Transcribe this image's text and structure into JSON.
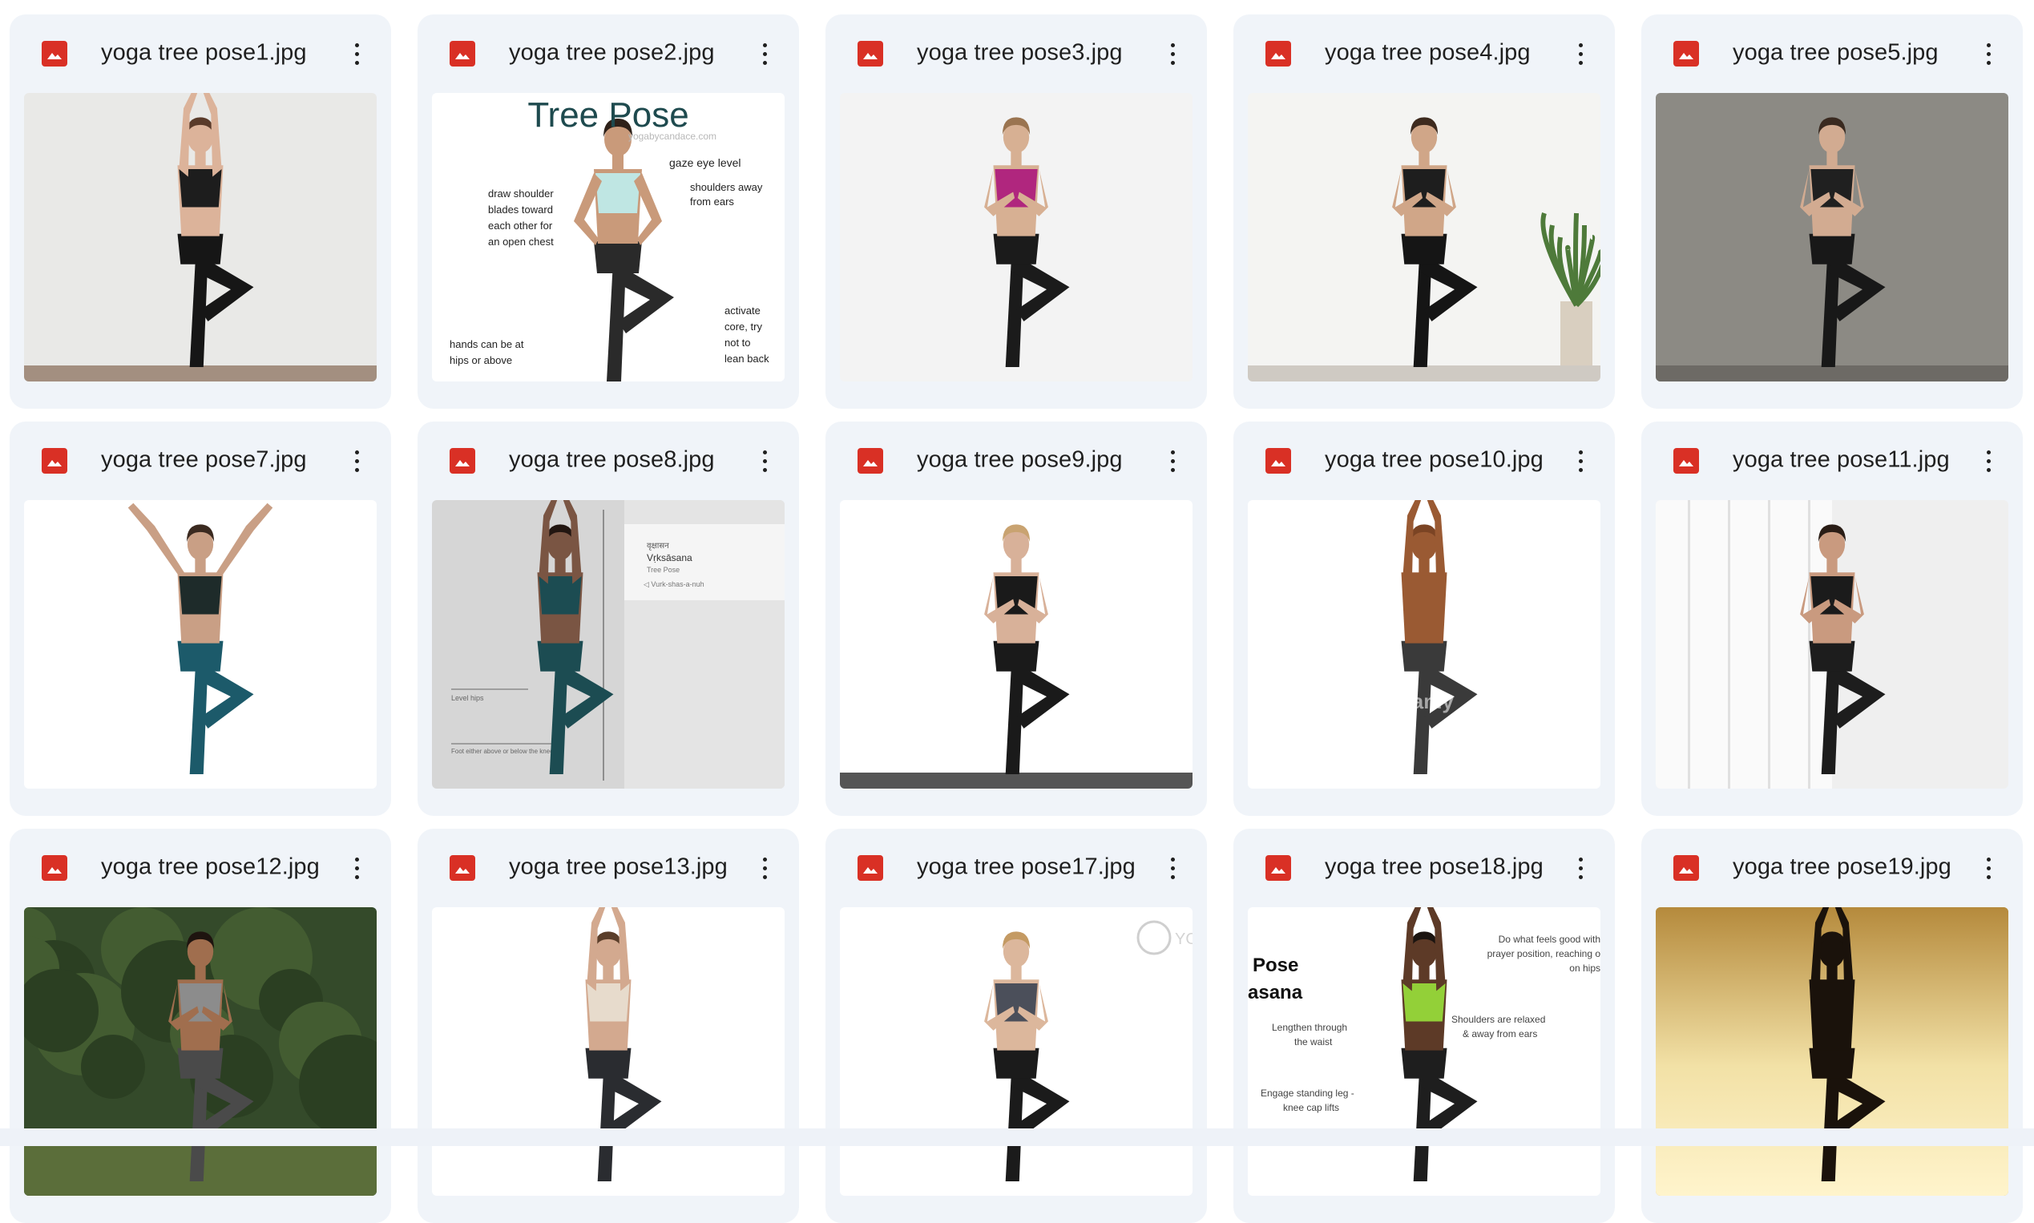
{
  "files": [
    {
      "name": "yoga tree pose1.jpg",
      "thumb": {
        "bg": "#e9e9e7",
        "floor": "#a38f80",
        "skin": "#dcb39a",
        "top": "#1d1d1d",
        "bottom": "#161616",
        "hair": "#5a3b2a",
        "arms": "up"
      }
    },
    {
      "name": "yoga tree pose2.jpg",
      "thumb": {
        "bg": "#ffffff",
        "skin": "#c99a7a",
        "top": "#bfe6e3",
        "bottom": "#2a2a2a",
        "hair": "#2e2119",
        "arms": "hips",
        "diagram": true,
        "texts": {
          "title": "Tree Pose",
          "site": "yogabycandace.com",
          "gaze": "gaze eye level",
          "shoulders": "shoulders away from ears",
          "blades": "draw shoulder blades toward each other for an open chest",
          "core": "activate core, try not to lean back",
          "hands": "hands can be at hips or above"
        }
      }
    },
    {
      "name": "yoga tree pose3.jpg",
      "thumb": {
        "bg": "#f3f3f3",
        "skin": "#d7b093",
        "top": "#b0267e",
        "bottom": "#1b1b1b",
        "hair": "#9a7450",
        "arms": "prayer"
      }
    },
    {
      "name": "yoga tree pose4.jpg",
      "thumb": {
        "bg": "#f4f4f2",
        "floor": "#cfcac3",
        "skin": "#d0a688",
        "top": "#1e1e1e",
        "bottom": "#151515",
        "hair": "#3d2a1e",
        "arms": "prayer",
        "plant": true
      }
    },
    {
      "name": "yoga tree pose5.jpg",
      "thumb": {
        "bg": "#8c8a84",
        "floor": "#6d6a65",
        "skin": "#d2ab91",
        "top": "#202020",
        "bottom": "#181818",
        "hair": "#3a2a20",
        "arms": "prayer"
      }
    },
    {
      "name": "yoga tree pose7.jpg",
      "thumb": {
        "bg": "#ffffff",
        "skin": "#c99f85",
        "top": "#1e2b2a",
        "bottom": "#1c5a6a",
        "hair": "#3b2a20",
        "arms": "v"
      }
    },
    {
      "name": "yoga tree pose8.jpg",
      "thumb": {
        "bg": "#d6d6d6",
        "skin": "#7a5543",
        "top": "#1c4c52",
        "bottom": "#1c4c52",
        "hair": "#221611",
        "arms": "up",
        "panel": true,
        "texts": {
          "script": "वृक्षासन",
          "sanskrit": "Vṛksāsana",
          "english": "Tree Pose",
          "phonetic": "Vurk-shas-a-nuh",
          "hips": "Level hips",
          "foot": "Foot either above or below the knee"
        }
      }
    },
    {
      "name": "yoga tree pose9.jpg",
      "thumb": {
        "bg": "#ffffff",
        "floor": "#555555",
        "skin": "#d8b199",
        "top": "#1a1a1a",
        "bottom": "#1a1a1a",
        "hair": "#c9a371",
        "arms": "prayer"
      }
    },
    {
      "name": "yoga tree pose10.jpg",
      "thumb": {
        "bg": "#ffffff",
        "skin": "#9a5a33",
        "top": "#9a5a33",
        "bottom": "#3a3a3a",
        "hair": "#7b4424",
        "arms": "up",
        "watermark": "alamy"
      }
    },
    {
      "name": "yoga tree pose11.jpg",
      "thumb": {
        "bg": "#efefef",
        "skin": "#c99a7f",
        "top": "#1b1b1b",
        "bottom": "#1d1d1d",
        "hair": "#2a1d16",
        "arms": "prayer",
        "window": true
      }
    },
    {
      "name": "yoga tree pose12.jpg",
      "thumb": {
        "bg": "#344a2a",
        "skin": "#a06e4e",
        "top": "#8c8c8c",
        "bottom": "#4a4a4a",
        "hair": "#1e140f",
        "arms": "prayer",
        "forest": true
      }
    },
    {
      "name": "yoga tree pose13.jpg",
      "thumb": {
        "bg": "#ffffff",
        "skin": "#d3a98f",
        "top": "#e7dbcc",
        "bottom": "#2a2c30",
        "hair": "#5a3e2a",
        "arms": "up"
      }
    },
    {
      "name": "yoga tree pose17.jpg",
      "thumb": {
        "bg": "#ffffff",
        "skin": "#dcb79c",
        "top": "#4b4f5a",
        "bottom": "#1b1b1b",
        "hair": "#c49a63",
        "arms": "prayer",
        "logo_text": "YO BA"
      }
    },
    {
      "name": "yoga tree pose18.jpg",
      "thumb": {
        "bg": "#ffffff",
        "skin": "#5d3a27",
        "top": "#93d038",
        "bottom": "#1e1e1e",
        "hair": "#1b1410",
        "arms": "up",
        "infographic": true,
        "texts": {
          "pose": "Pose",
          "asana": "asana",
          "waist": "Lengthen through the waist",
          "leg": "Engage standing leg - knee cap lifts",
          "feels": "Do what feels good with prayer position, reaching on hips",
          "shoulders": "Shoulders are relaxed & away from ears"
        }
      }
    },
    {
      "name": "yoga tree pose19.jpg",
      "thumb": {
        "bg": "#caa655",
        "skin": "#1a120b",
        "top": "#1a120b",
        "bottom": "#1a120b",
        "hair": "#1a120b",
        "arms": "up",
        "sunset": true
      }
    }
  ]
}
